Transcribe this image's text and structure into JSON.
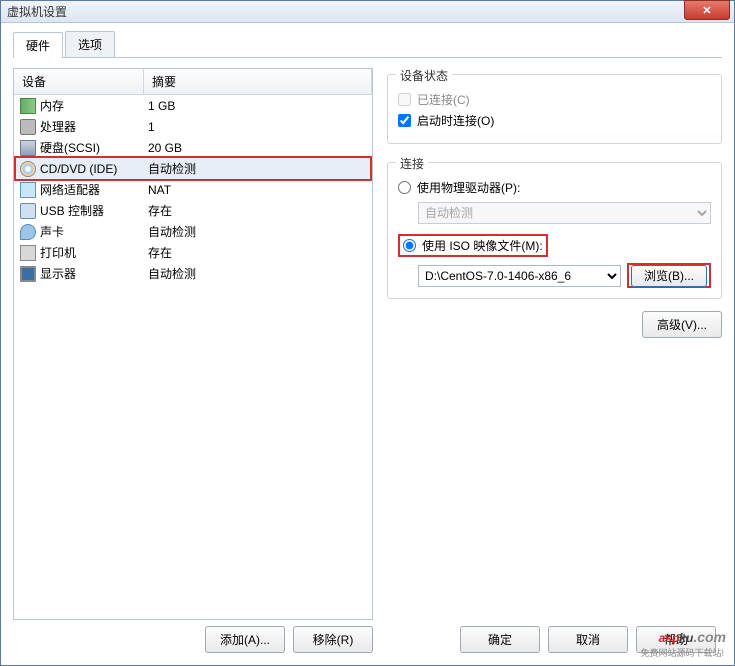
{
  "window": {
    "title": "虚拟机设置"
  },
  "tabs": {
    "hardware": "硬件",
    "options": "选项"
  },
  "list": {
    "col_device": "设备",
    "col_summary": "摘要",
    "rows": [
      {
        "icon": "ic-mem",
        "device": "内存",
        "summary": "1 GB"
      },
      {
        "icon": "ic-cpu",
        "device": "处理器",
        "summary": "1"
      },
      {
        "icon": "ic-disk",
        "device": "硬盘(SCSI)",
        "summary": "20 GB"
      },
      {
        "icon": "ic-cd",
        "device": "CD/DVD (IDE)",
        "summary": "自动检测",
        "selected": true
      },
      {
        "icon": "ic-net",
        "device": "网络适配器",
        "summary": "NAT"
      },
      {
        "icon": "ic-usb",
        "device": "USB 控制器",
        "summary": "存在"
      },
      {
        "icon": "ic-snd",
        "device": "声卡",
        "summary": "自动检测"
      },
      {
        "icon": "ic-prn",
        "device": "打印机",
        "summary": "存在"
      },
      {
        "icon": "ic-mon",
        "device": "显示器",
        "summary": "自动检测"
      }
    ]
  },
  "left_buttons": {
    "add": "添加(A)...",
    "remove": "移除(R)"
  },
  "status_group": {
    "title": "设备状态",
    "connected": "已连接(C)",
    "connect_on_power": "启动时连接(O)"
  },
  "connect_group": {
    "title": "连接",
    "physical": "使用物理驱动器(P):",
    "physical_drive_option": "自动检测",
    "iso": "使用 ISO 映像文件(M):",
    "iso_path": "D:\\CentOS-7.0-1406-x86_6",
    "browse": "浏览(B)..."
  },
  "advanced": "高级(V)...",
  "footer": {
    "ok": "确定",
    "cancel": "取消",
    "help": "帮助"
  },
  "watermark": {
    "asp": "asp",
    "ku": "ku",
    "dotcom": ".com",
    "sub": "免费网站源码下载站!"
  }
}
